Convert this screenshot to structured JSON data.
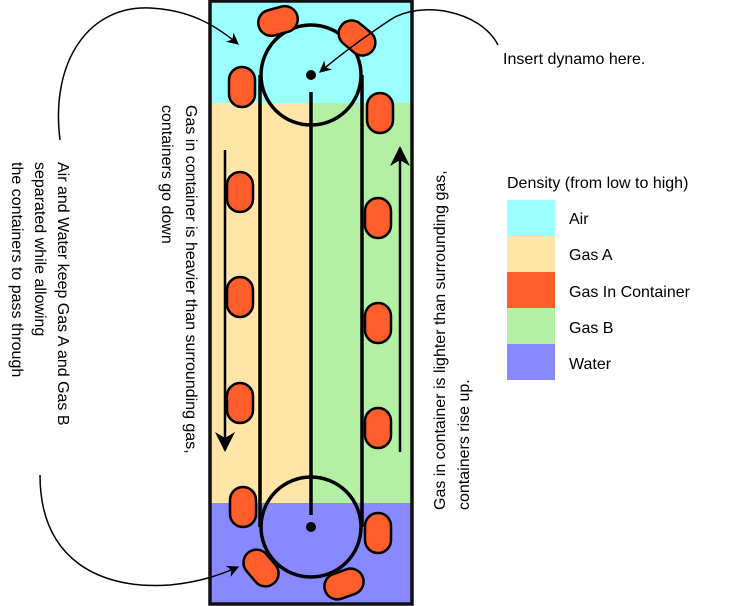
{
  "colors": {
    "air": "#99ffff",
    "gas_a": "#ffe5a8",
    "gas_in_container": "#ff5e2a",
    "gas_b": "#b3f0a4",
    "water": "#8888ff",
    "outline": "#000000"
  },
  "annotations": {
    "dynamo": "Insert dynamo here.",
    "down_line1": "Gas in container is heavier than surrounding gas,",
    "down_line2": "containers go down",
    "up_line1": "Gas in container is lighter than surrounding gas,",
    "up_line2": "containers rise up.",
    "seal_line1": "Air and Water keep Gas A and Gas B",
    "seal_line2": "separated while allowing",
    "seal_line3": "the containers to pass through"
  },
  "legend": {
    "title": "Density (from low to high)",
    "items": [
      {
        "label": "Air",
        "color": "#99ffff"
      },
      {
        "label": "Gas A",
        "color": "#ffe5a8"
      },
      {
        "label": "Gas In Container",
        "color": "#ff5e2a"
      },
      {
        "label": "Gas B",
        "color": "#b3f0a4"
      },
      {
        "label": "Water",
        "color": "#8888ff"
      }
    ]
  }
}
